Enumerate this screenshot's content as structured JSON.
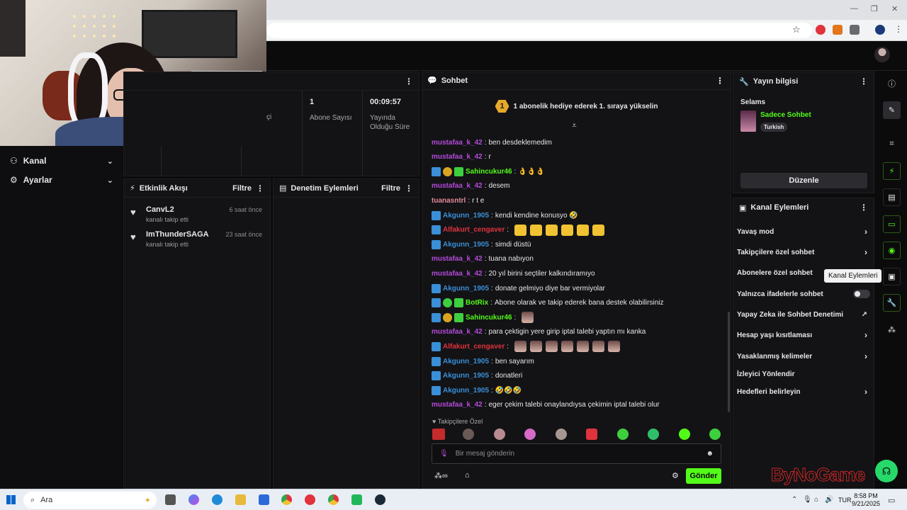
{
  "sidebar": {
    "items": [
      {
        "label": "Kanal",
        "icon": "users-icon"
      },
      {
        "label": "Ayarlar",
        "icon": "gear-icon"
      }
    ]
  },
  "stats": {
    "partial_label": "çi",
    "items": [
      {
        "value": "1",
        "label": "Abone Sayısı"
      },
      {
        "value": "00:09:57",
        "label": "Yayında Olduğu Süre"
      }
    ]
  },
  "activity": {
    "title": "Etkinlik Akışı",
    "filter": "Filtre",
    "items": [
      {
        "name": "CanvL2",
        "sub": "kanalı takip etti",
        "time": "6 saat önce"
      },
      {
        "name": "ImThunderSAGA",
        "sub": "kanalı takip etti",
        "time": "23 saat önce"
      }
    ]
  },
  "moderation": {
    "title": "Denetim Eylemleri",
    "filter": "Filtre"
  },
  "chat": {
    "title": "Sohbet",
    "banner_count": "1",
    "banner_text": "1 abonelik hediye ederek 1. sıraya yükselin",
    "messages": [
      {
        "user": "mustafaa_k_42",
        "text": "ben desdeklemedim"
      },
      {
        "user": "mustafaa_k_42",
        "text": "r"
      },
      {
        "user": "Sahincukur46",
        "text": "👌👌👌"
      },
      {
        "user": "mustafaa_k_42",
        "text": "desem"
      },
      {
        "user": "tuanasntrl",
        "text": "r t e"
      },
      {
        "user": "Akgunn_1905",
        "text": "kendi kendine konusyo 🤣"
      },
      {
        "user": "Alfakurt_cengaver",
        "text": ""
      },
      {
        "user": "Akgunn_1905",
        "text": "simdi düstü"
      },
      {
        "user": "mustafaa_k_42",
        "text": "tuana nabıyon"
      },
      {
        "user": "mustafaa_k_42",
        "text": "20 yıl birini seçtiler kalkındıramıyo"
      },
      {
        "user": "Akgunn_1905",
        "text": "donate gelmiyo diye bar vermiyolar"
      },
      {
        "user": "BotRix",
        "text": "Abone olarak ve takip ederek bana destek olabilirsiniz"
      },
      {
        "user": "Sahincukur46",
        "text": ""
      },
      {
        "user": "mustafaa_k_42",
        "text": "para çektigin yere girip iptal talebi yaptın mı kanka"
      },
      {
        "user": "Alfakurt_cengaver",
        "text": ""
      },
      {
        "user": "Akgunn_1905",
        "text": "ben sayarım"
      },
      {
        "user": "Akgunn_1905",
        "text": "donatleri"
      },
      {
        "user": "Akgunn_1905",
        "text": "🤣🤣🤣"
      },
      {
        "user": "mustafaa_k_42",
        "text": "eger çekim talebi onaylandıysa çekimin iptal talebi olur"
      }
    ],
    "followers_only": "Takipçilere Özel",
    "input_placeholder": "Bir mesaj gönderin",
    "send_label": "Gönder"
  },
  "stream_info": {
    "title": "Yayın bilgisi",
    "stream_title": "Selams",
    "category": "Sadece Sohbet",
    "language": "Turkish",
    "edit_label": "Düzenle"
  },
  "channel_actions": {
    "title": "Kanal Eylemleri",
    "items": [
      {
        "label": "Yavaş mod",
        "control": "arrow"
      },
      {
        "label": "Takipçilere özel sohbet",
        "control": "arrow"
      },
      {
        "label": "Abonelere özel sohbet",
        "control": "none"
      },
      {
        "label": "Yalnızca ifadelerle sohbet",
        "control": "toggle"
      },
      {
        "label": "Yapay Zeka ile Sohbet Denetimi",
        "control": "external"
      },
      {
        "label": "Hesap yaşı kısıtlaması",
        "control": "arrow"
      },
      {
        "label": "Yasaklanmış kelimeler",
        "control": "arrow"
      },
      {
        "label": "İzleyici Yönlendir",
        "control": "none"
      },
      {
        "label": "Hedefleri belirleyin",
        "control": "arrow"
      }
    ],
    "tooltip": "Kanal Eylemleri"
  },
  "taskbar": {
    "search_placeholder": "Ara",
    "lang": "TUR",
    "time": "8:58 PM",
    "date": "9/21/2025"
  },
  "watermark": "ByNoGame",
  "colors": {
    "accent": "#53fc18",
    "mod_badge": "#3a8fd6",
    "sub_badge": "#3ecf3e",
    "purple_user": "#b44bd8",
    "blue_user": "#3a8fd6",
    "red_user": "#e0333c",
    "green_user": "#53fc18",
    "pink_user": "#e38a9a"
  }
}
